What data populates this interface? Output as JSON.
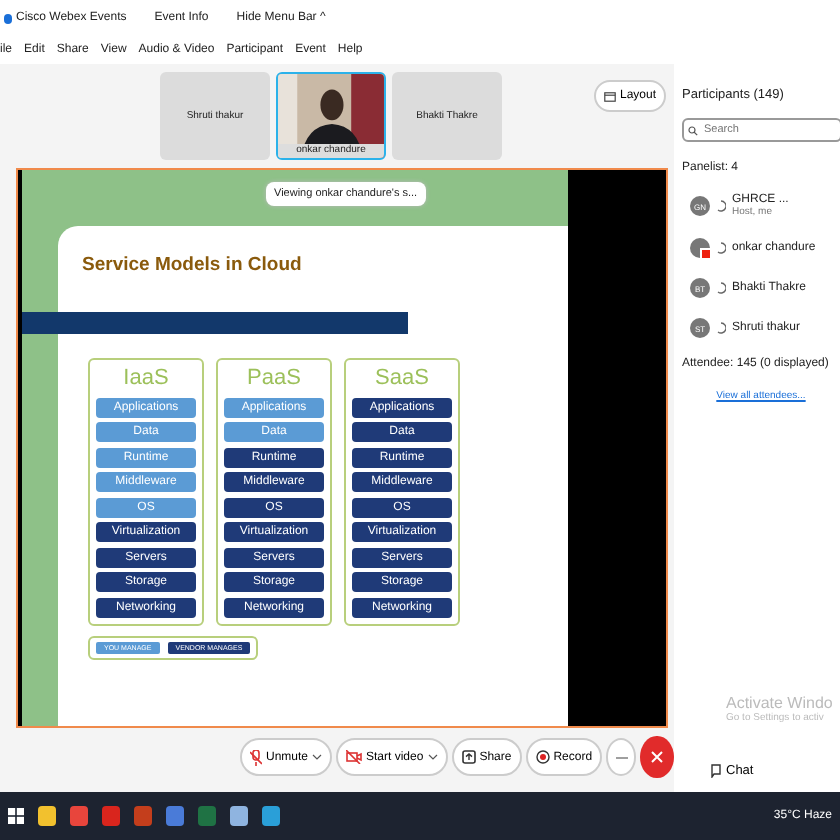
{
  "title_bar": {
    "app": "Cisco Webex Events",
    "event_info": "Event Info",
    "hide_menu": "Hide Menu Bar ^"
  },
  "menu": [
    "ile",
    "Edit",
    "Share",
    "View",
    "Audio & Video",
    "Participant",
    "Event",
    "Help"
  ],
  "video_strip": [
    {
      "name": "Shruti thakur",
      "kind": "blank",
      "selected": false
    },
    {
      "name": "onkar chandure",
      "kind": "video",
      "selected": true
    },
    {
      "name": "Bhakti Thakre",
      "kind": "blank",
      "selected": false
    }
  ],
  "layout_button": "Layout",
  "stage": {
    "banner": "Viewing onkar chandure's s...",
    "slide": {
      "title": "Service Models in Cloud",
      "columns": [
        {
          "name": "IaaS",
          "layers": [
            {
              "label": "Applications",
              "kind": "you"
            },
            {
              "label": "Data",
              "kind": "you"
            },
            {
              "label": "Runtime",
              "kind": "you"
            },
            {
              "label": "Middleware",
              "kind": "you"
            },
            {
              "label": "OS",
              "kind": "you"
            },
            {
              "label": "Virtualization",
              "kind": "vendor"
            },
            {
              "label": "Servers",
              "kind": "vendor"
            },
            {
              "label": "Storage",
              "kind": "vendor"
            },
            {
              "label": "Networking",
              "kind": "vendor"
            }
          ]
        },
        {
          "name": "PaaS",
          "layers": [
            {
              "label": "Applications",
              "kind": "you"
            },
            {
              "label": "Data",
              "kind": "you"
            },
            {
              "label": "Runtime",
              "kind": "vendor"
            },
            {
              "label": "Middleware",
              "kind": "vendor"
            },
            {
              "label": "OS",
              "kind": "vendor"
            },
            {
              "label": "Virtualization",
              "kind": "vendor"
            },
            {
              "label": "Servers",
              "kind": "vendor"
            },
            {
              "label": "Storage",
              "kind": "vendor"
            },
            {
              "label": "Networking",
              "kind": "vendor"
            }
          ]
        },
        {
          "name": "SaaS",
          "layers": [
            {
              "label": "Applications",
              "kind": "vendor"
            },
            {
              "label": "Data",
              "kind": "vendor"
            },
            {
              "label": "Runtime",
              "kind": "vendor"
            },
            {
              "label": "Middleware",
              "kind": "vendor"
            },
            {
              "label": "OS",
              "kind": "vendor"
            },
            {
              "label": "Virtualization",
              "kind": "vendor"
            },
            {
              "label": "Servers",
              "kind": "vendor"
            },
            {
              "label": "Storage",
              "kind": "vendor"
            },
            {
              "label": "Networking",
              "kind": "vendor"
            }
          ]
        }
      ],
      "legend": [
        {
          "label": "YOU MANAGE",
          "kind": "you"
        },
        {
          "label": "VENDOR MANAGES",
          "kind": "vendor"
        }
      ]
    }
  },
  "controls": [
    {
      "label": "Unmute",
      "kind": "mic",
      "caret": true
    },
    {
      "label": "Start video",
      "kind": "video",
      "caret": true
    },
    {
      "label": "Share",
      "kind": "share",
      "caret": false
    },
    {
      "label": "Record",
      "kind": "record",
      "caret": false
    }
  ],
  "participants": {
    "title": "Participants (149)",
    "search": {
      "placeholder": "Search"
    },
    "panelist_header": "Panelist: 4",
    "panelists": [
      {
        "initials": "GN",
        "name": "GHRCE ...",
        "role": "Host, me",
        "muted_badge": false
      },
      {
        "name": "onkar chandure",
        "muted_badge": true
      },
      {
        "initials": "BT",
        "name": "Bhakti Thakre",
        "muted_badge": false
      },
      {
        "initials": "ST",
        "name": "Shruti thakur",
        "muted_badge": false
      }
    ],
    "attendee_header": "Attendee: 145 (0 displayed)",
    "view_all": "View all attendees..."
  },
  "activation": [
    "Activate Windo",
    "Go to Settings to activ"
  ],
  "chat_button": "Chat",
  "taskbar": {
    "apps": [
      {
        "color": "#f2c12e"
      },
      {
        "color": "#e8453c"
      },
      {
        "color": "#d9251d"
      },
      {
        "color": "#c43e1c"
      },
      {
        "color": "#4a7bd8"
      },
      {
        "color": "#1f7244"
      },
      {
        "color": "#8fb4e0"
      },
      {
        "color": "#2a9fd8"
      }
    ],
    "weather": "35°C Haze"
  }
}
